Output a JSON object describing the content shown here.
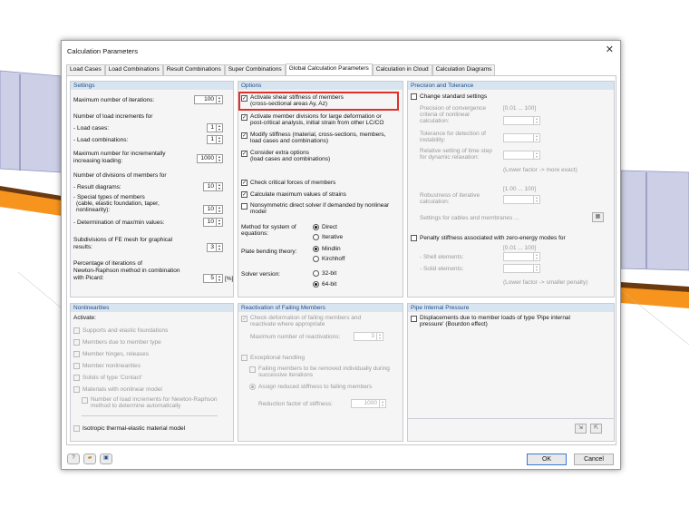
{
  "dialog": {
    "title": "Calculation Parameters",
    "close_glyph": "✕"
  },
  "tabs": [
    "Load Cases",
    "Load Combinations",
    "Result Combinations",
    "Super Combinations",
    "Global Calculation Parameters",
    "Calculation in Cloud",
    "Calculation Diagrams"
  ],
  "settings": {
    "header": "Settings",
    "max_iterations_label": "Maximum number of iterations:",
    "max_iterations": "100",
    "load_increments_label": "Number of load increments for",
    "load_cases_label": "- Load cases:",
    "load_cases": "1",
    "load_combinations_label": "- Load combinations:",
    "load_combinations": "1",
    "max_incremental_label1": "Maximum number for incrementally",
    "max_incremental_label2": "increasing loading:",
    "max_incremental": "1000",
    "divisions_label": "Number of divisions of members for",
    "result_diagrams_label": "- Result diagrams:",
    "result_diagrams": "10",
    "special_types_label1": "- Special types of members",
    "special_types_label2": "(cable, elastic foundation, taper,",
    "special_types_label3": "nonlinearity):",
    "special_types": "10",
    "max_min_label": "- Determination of max/min values:",
    "max_min": "10",
    "fe_mesh_label1": "Subdivisions of FE mesh for graphical",
    "fe_mesh_label2": "results:",
    "fe_mesh": "3",
    "percentage_label1": "Percentage of iterations of",
    "percentage_label2": "Newton-Raphson method in combination",
    "percentage_label3": "with Picard:",
    "percentage": "5",
    "percentage_unit": "[%]"
  },
  "options": {
    "header": "Options",
    "shear_label1": "Activate shear stiffness of members",
    "shear_label2": "(cross-sectional areas Ay, Az)",
    "divisions_label1": "Activate member divisions for large deformation or",
    "divisions_label2": "post-critical analysis, initial strain from other LC/CO",
    "modify_label1": "Modify stiffness (material, cross-sections, members,",
    "modify_label2": "load cases and combinations)",
    "extra_label1": "Consider extra options",
    "extra_label2": "(load cases and combinations)",
    "critical_label": "Check critical forces of members",
    "max_strains_label": "Calculate maximum values of strains",
    "nonsym_label1": "Nonsymmetric direct solver if demanded by nonlinear",
    "nonsym_label2": "model",
    "method_label1": "Method for system of",
    "method_label2": "equations:",
    "direct": "Direct",
    "iterative": "Iterative",
    "bending_label": "Plate bending theory:",
    "mindlin": "Mindlin",
    "kirchhoff": "Kirchhoff",
    "solver_label": "Solver version:",
    "v32": "32-bit",
    "v64": "64-bit",
    "highlight_color": "#e0302a"
  },
  "precision": {
    "header": "Precision and Tolerance",
    "change_label": "Change standard settings",
    "range1": "[0.01 ... 100]",
    "conv_label1": "Precision of convergence",
    "conv_label2": "criteria of nonlinear",
    "conv_label3": "calculation:",
    "instab_label1": "Tolerance for detection of",
    "instab_label2": "instability:",
    "time_label1": "Relative setting of time step",
    "time_label2": "for dynamic relaxation:",
    "hint1": "(Lower factor -> more exact)",
    "range2": "[1.00 ... 100]",
    "robust_label1": "Robustness of iterative",
    "robust_label2": "calculation:",
    "cables_label": "Settings for cables and membranes ...",
    "penalty_label": "Penalty stiffness associated with zero-energy modes for",
    "range3": "[0.01 ... 100]",
    "shell_label": "- Shell elements:",
    "solid_label": "- Solid elements:",
    "hint2": "(Lower factor -> smaller penalty)"
  },
  "nonlinearities": {
    "header": "Nonlinearities",
    "activate_label": "Activate:",
    "items": [
      "Supports and elastic foundations",
      "Members due to member type",
      "Member hinges, releases",
      "Member nonlinearities",
      "Solids of type 'Contact'",
      "Materials with nonlinear model"
    ],
    "nr_label1": "Number of load increments for Newton-Raphson",
    "nr_label2": "method to determine automatically",
    "isotropic_label": "Isotropic thermal-elastic material model"
  },
  "failing": {
    "header": "Reactivation of Failing Members",
    "check_label1": "Check deformation of failing members and",
    "check_label2": "reactivate where appropriate",
    "max_react_label": "Maximum number of reactivations:",
    "max_react": "3",
    "exceptional_label": "Exceptional handling",
    "remove_label1": "Failing members to be removed individually during",
    "remove_label2": "successive iterations",
    "assign_label": "Assign reduced stiffness to failing members",
    "reduction_label": "Reduction factor of stiffness:",
    "reduction": "1000"
  },
  "pipe": {
    "header": "Pipe Internal Pressure",
    "label1": "Displacements due to member loads of type 'Pipe internal",
    "label2": "pressure' (Bourdon effect)"
  },
  "footer": {
    "ok": "OK",
    "cancel": "Cancel"
  }
}
